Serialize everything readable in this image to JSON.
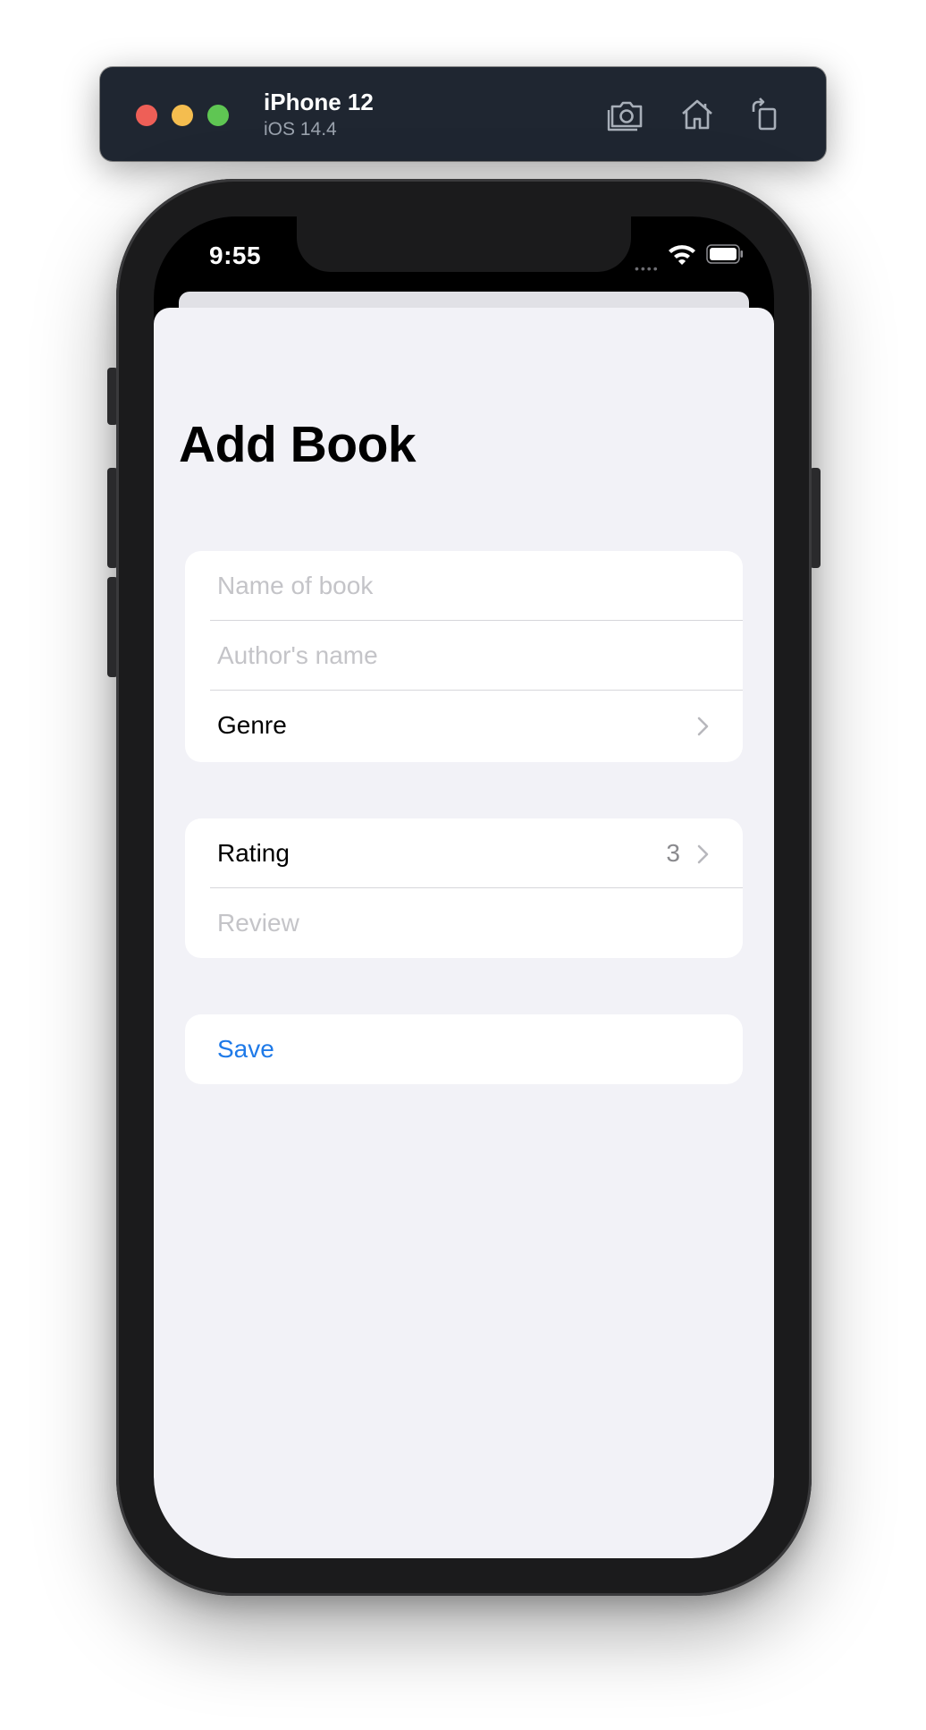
{
  "simulator": {
    "device_name": "iPhone 12",
    "os_version": "iOS 14.4",
    "toolbar_icons": [
      "screenshot-icon",
      "home-icon",
      "rotate-icon"
    ]
  },
  "status_bar": {
    "time": "9:55",
    "icons": [
      "wifi-icon",
      "battery-icon"
    ]
  },
  "form": {
    "title": "Add Book",
    "section1": {
      "name_placeholder": "Name of book",
      "author_placeholder": "Author's name",
      "genre_label": "Genre"
    },
    "section2": {
      "rating_label": "Rating",
      "rating_value": "3",
      "review_placeholder": "Review"
    },
    "section3": {
      "save_label": "Save"
    }
  },
  "colors": {
    "accent": "#1f7ae8",
    "background": "#f2f2f7",
    "sim_bar": "#1f2631"
  }
}
